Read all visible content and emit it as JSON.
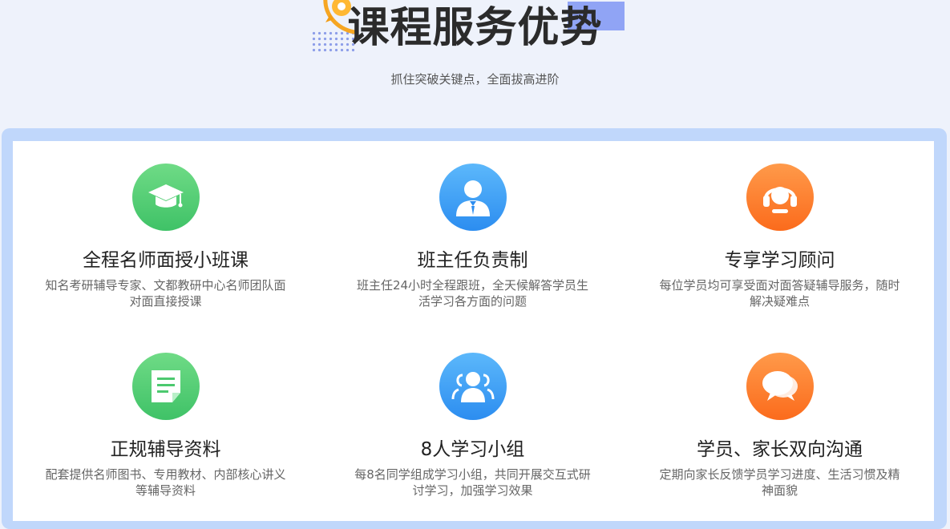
{
  "header": {
    "title": "课程服务优势",
    "subtitle": "抓住突破关键点，全面拔高进阶"
  },
  "colors": {
    "green": "#4cc96f",
    "blue": "#3a9cf4",
    "orange": "#fc7a2c",
    "panel_border": "#c0d7fb",
    "background": "#eef2fb"
  },
  "features": [
    {
      "icon": "graduation-cap-icon",
      "color": "green",
      "title": "全程名师面授小班课",
      "desc": "知名考研辅导专家、文都教研中心名师团队面对面直接授课"
    },
    {
      "icon": "teacher-person-icon",
      "color": "blue",
      "title": "班主任负责制",
      "desc": "班主任24小时全程跟班，全天候解答学员生活学习各方面的问题"
    },
    {
      "icon": "headset-icon",
      "color": "orange",
      "title": "专享学习顾问",
      "desc": "每位学员均可享受面对面答疑辅导服务，随时解决疑难点"
    },
    {
      "icon": "document-icon",
      "color": "green",
      "title": "正规辅导资料",
      "desc": "配套提供名师图书、专用教材、内部核心讲义等辅导资料"
    },
    {
      "icon": "group-people-icon",
      "color": "blue",
      "title": "8人学习小组",
      "desc": "每8名同学组成学习小组，共同开展交互式研讨学习，加强学习效果"
    },
    {
      "icon": "chat-bubbles-icon",
      "color": "orange",
      "title": "学员、家长双向沟通",
      "desc": "定期向家长反馈学员学习进度、生活习惯及精神面貌"
    }
  ]
}
